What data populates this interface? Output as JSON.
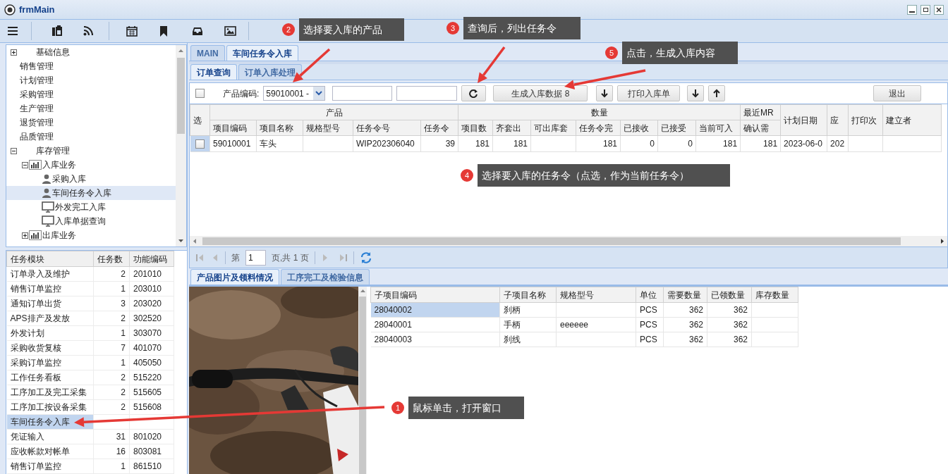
{
  "window": {
    "title": "frmMain"
  },
  "nav_tree": [
    {
      "label": "基础信息",
      "kind": "group",
      "expanded": false,
      "selected": false
    },
    {
      "label": "销售管理",
      "kind": "plain",
      "selected": false
    },
    {
      "label": "计划管理",
      "kind": "plain",
      "selected": false
    },
    {
      "label": "采购管理",
      "kind": "plain",
      "selected": false
    },
    {
      "label": "生产管理",
      "kind": "plain",
      "selected": false
    },
    {
      "label": "退货管理",
      "kind": "plain",
      "selected": false
    },
    {
      "label": "品质管理",
      "kind": "plain",
      "selected": false
    },
    {
      "label": "库存管理",
      "kind": "group",
      "expanded": true,
      "selected": false,
      "children": [
        {
          "label": "入库业务",
          "kind": "chart",
          "expanded": true,
          "selected": false,
          "children": [
            {
              "label": "采购入库",
              "kind": "user",
              "selected": false
            },
            {
              "label": "车间任务令入库",
              "kind": "user",
              "selected": true
            },
            {
              "label": "外发完工入库",
              "kind": "monitor",
              "selected": false
            },
            {
              "label": "入库单据查询",
              "kind": "monitor",
              "selected": false
            }
          ]
        },
        {
          "label": "出库业务",
          "kind": "chart",
          "expanded": false,
          "selected": false
        }
      ]
    }
  ],
  "task_grid": {
    "columns": [
      "任务模块",
      "任务数",
      "功能编码"
    ],
    "rows": [
      {
        "cells": [
          "订单录入及维护",
          "2",
          "201010"
        ],
        "selected": false
      },
      {
        "cells": [
          "销售订单监控",
          "1",
          "203010"
        ],
        "selected": false
      },
      {
        "cells": [
          "通知订单出货",
          "3",
          "203020"
        ],
        "selected": false
      },
      {
        "cells": [
          "APS排产及发放",
          "2",
          "302520"
        ],
        "selected": false
      },
      {
        "cells": [
          "外发计划",
          "1",
          "303070"
        ],
        "selected": false
      },
      {
        "cells": [
          "采购收货复核",
          "7",
          "401070"
        ],
        "selected": false
      },
      {
        "cells": [
          "采购订单监控",
          "1",
          "405050"
        ],
        "selected": false
      },
      {
        "cells": [
          "工作任务看板",
          "2",
          "515220"
        ],
        "selected": false
      },
      {
        "cells": [
          "工序加工及完工采集",
          "2",
          "515605"
        ],
        "selected": false
      },
      {
        "cells": [
          "工序加工按设备采集",
          "2",
          "515608"
        ],
        "selected": false
      },
      {
        "cells": [
          "车间任务令入库",
          null,
          null
        ],
        "selected": true
      },
      {
        "cells": [
          "凭证输入",
          "31",
          "801020"
        ],
        "selected": false
      },
      {
        "cells": [
          "应收帐款对帐单",
          "16",
          "803081"
        ],
        "selected": false
      },
      {
        "cells": [
          "销售订单监控",
          "1",
          "861510"
        ],
        "selected": false
      }
    ]
  },
  "tabs": [
    {
      "label": "MAIN",
      "selected": false
    },
    {
      "label": "车间任务令入库",
      "selected": true
    }
  ],
  "sub_tabs": [
    {
      "label": "订单查询",
      "selected": true
    },
    {
      "label": "订单入库处理",
      "selected": false
    }
  ],
  "filter": {
    "select_all_checked": false,
    "label": "产品编码:",
    "product_code": "59010001 -",
    "buttons": [
      {
        "kind": "text",
        "label": "生成入库数据 8"
      },
      {
        "kind": "down"
      },
      {
        "kind": "text",
        "label": "打印入库单"
      },
      {
        "kind": "down"
      },
      {
        "kind": "up"
      },
      {
        "kind": "text",
        "label": "退出"
      }
    ]
  },
  "order_grid": {
    "header_rows": [
      [
        "选",
        "产品",
        "数量",
        "最近MR",
        "计划日期",
        "应",
        "打印次",
        "建立者"
      ],
      [
        "项目编码",
        "项目名称",
        "规格型号",
        "任务令号",
        "任务令",
        "项目数",
        "齐套出",
        "可出库套",
        "任务令完",
        "已接收",
        "已接受",
        "当前可入",
        "确认需"
      ]
    ],
    "rows": [
      {
        "checked": false,
        "selected": true,
        "cells": [
          "59010001",
          "车头",
          null,
          "WIP202306040",
          "39",
          "181",
          "181",
          null,
          "181",
          "0",
          "0",
          "181",
          "181",
          "2023-06-0",
          "202",
          null,
          null
        ]
      }
    ]
  },
  "pager": {
    "before": "第",
    "page": "1",
    "after": "页,共 1 页"
  },
  "bottom_tabs": [
    {
      "label": "产品图片及领料情况",
      "selected": true
    },
    {
      "label": "工序完工及检验信息",
      "selected": false
    }
  ],
  "material_grid": {
    "columns": [
      "子项目编码",
      "子项目名称",
      "规格型号",
      "单位",
      "需要数量",
      "已领数量",
      "库存数量"
    ],
    "rows": [
      {
        "cells": [
          "28040002",
          "刹柄",
          null,
          "PCS",
          "362",
          "362",
          null
        ],
        "selected": true
      },
      {
        "cells": [
          "28040001",
          "手柄",
          "eeeeee",
          "PCS",
          "362",
          "362",
          null
        ],
        "selected": false
      },
      {
        "cells": [
          "28040003",
          "刹线",
          null,
          "PCS",
          "362",
          "362",
          null
        ],
        "selected": false
      }
    ]
  },
  "callouts": [
    {
      "number": "2",
      "text": "选择要入库的产品"
    },
    {
      "number": "3",
      "text": "查询后，列出任务令"
    },
    {
      "number": "5",
      "text": "点击，生成入库内容"
    },
    {
      "number": "4",
      "text": "选择要入库的任务令（点选，作为当前任务令）"
    },
    {
      "number": "1",
      "text": "鼠标单击，打开窗口"
    }
  ]
}
